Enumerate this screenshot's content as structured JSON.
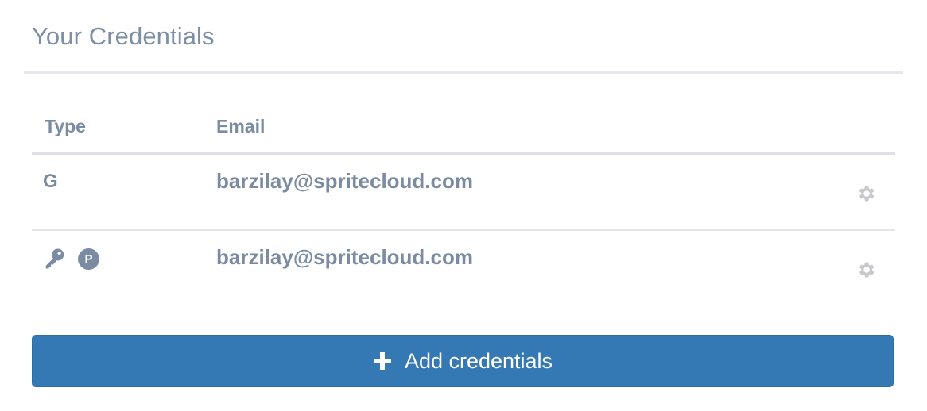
{
  "header": {
    "title": "Your Credentials"
  },
  "table": {
    "columns": {
      "type": "Type",
      "email": "Email"
    },
    "rows": [
      {
        "type_icons": [
          "google-icon"
        ],
        "type_glyph": "G",
        "email": "barzilay@spritecloud.com",
        "action_icon": "gear-icon"
      },
      {
        "type_icons": [
          "key-icon",
          "p-badge-icon"
        ],
        "badge_letter": "P",
        "email": "barzilay@spritecloud.com",
        "action_icon": "gear-icon"
      }
    ]
  },
  "actions": {
    "add_label": "Add credentials",
    "add_icon": "plus-icon"
  },
  "colors": {
    "text": "#7a8ba2",
    "primary": "#3579b4",
    "gear": "#c7c9cc",
    "divider": "#e3e5ea"
  }
}
